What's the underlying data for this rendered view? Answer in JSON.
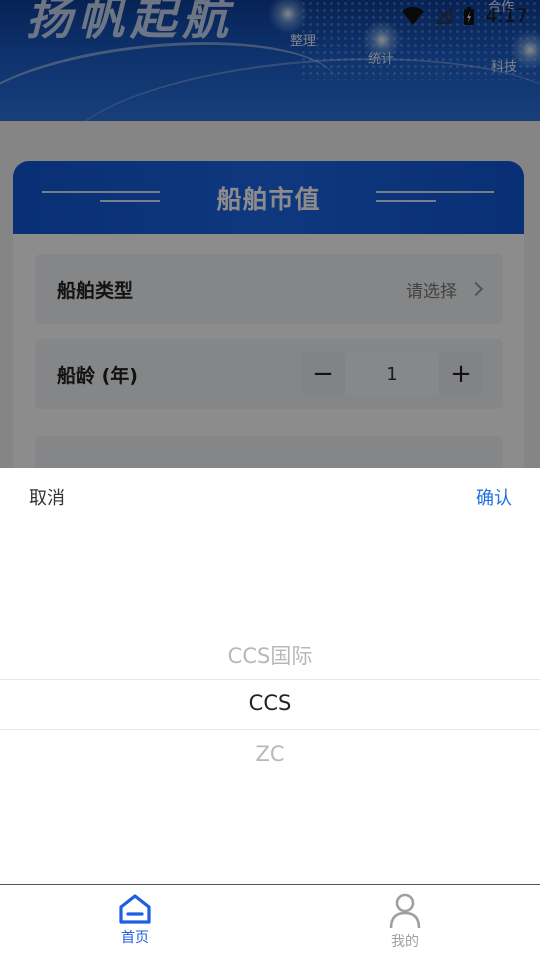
{
  "status_bar": {
    "time": "4:17"
  },
  "banner": {
    "slogan": "扬帆起航",
    "tags": [
      "整理",
      "统计",
      "科技",
      "合作"
    ]
  },
  "card": {
    "title": "船舶市值",
    "rows": [
      {
        "label": "船舶类型",
        "placeholder": "请选择"
      },
      {
        "label": "船龄 (年)",
        "value": "1",
        "decrement_symbol": "−",
        "increment_symbol": "+"
      }
    ]
  },
  "picker": {
    "cancel_label": "取消",
    "confirm_label": "确认",
    "options": [
      "CCS国际",
      "CCS",
      "ZC"
    ],
    "selected": "CCS"
  },
  "tabbar": {
    "items": [
      {
        "label": "首页",
        "icon": "home-icon",
        "active": true
      },
      {
        "label": "我的",
        "icon": "user-icon",
        "active": false
      }
    ]
  },
  "colors": {
    "accent": "#1d5fe0",
    "confirm": "#1d6fe0",
    "header_blue": "#1157d6"
  }
}
